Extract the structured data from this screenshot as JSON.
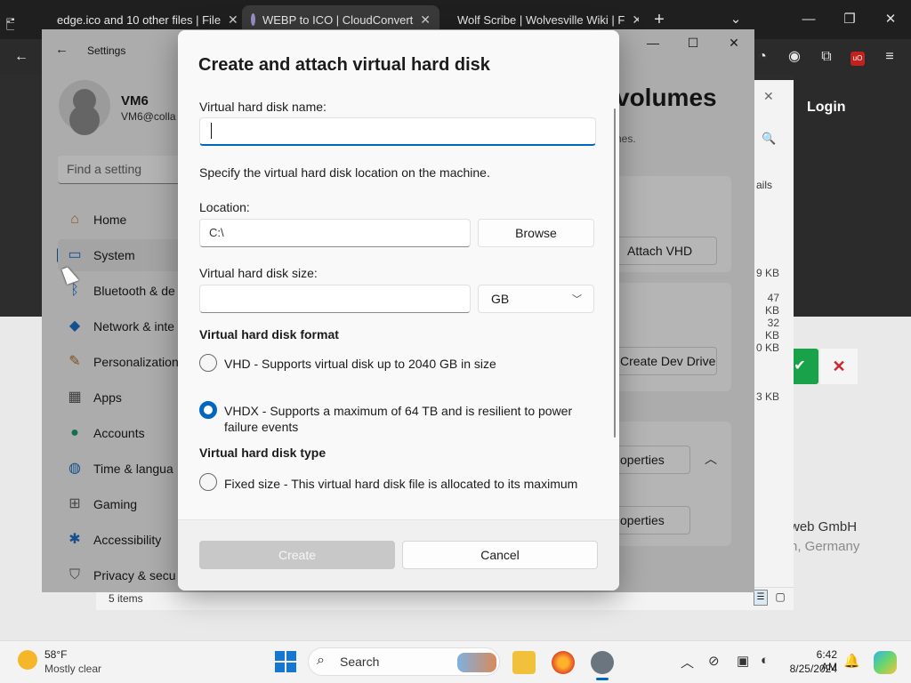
{
  "browser": {
    "tabs": [
      {
        "title": "edge.ico and 10 other files | File",
        "icon": "cloudconvert-red-icon"
      },
      {
        "title": "WEBP to ICO | CloudConvert",
        "icon": "cloudconvert-icon"
      },
      {
        "title": "Wolf Scribe | Wolvesville Wiki | F",
        "icon": "wolf-icon"
      }
    ],
    "new_tab": "+",
    "tab_close": "✕"
  },
  "webpage": {
    "login_title": "Login",
    "company_name": "web GmbH",
    "company_location": "h, Germany"
  },
  "explorer": {
    "file_sizes": [
      "9 KB",
      "47 KB",
      "32 KB",
      "0 KB",
      "3 KB"
    ],
    "partial_label": "ails",
    "items_count": "5 items"
  },
  "settings": {
    "window_title": "Settings",
    "user_name": "VM6",
    "user_email": "VM6@colla",
    "search_placeholder": "Find a setting",
    "nav": [
      {
        "label": "Home",
        "icon": "home-icon"
      },
      {
        "label": "System",
        "icon": "system-icon"
      },
      {
        "label": "Bluetooth & de",
        "icon": "bluetooth-icon"
      },
      {
        "label": "Network & inte",
        "icon": "wifi-icon"
      },
      {
        "label": "Personalization",
        "icon": "brush-icon"
      },
      {
        "label": "Apps",
        "icon": "apps-icon"
      },
      {
        "label": "Accounts",
        "icon": "person-icon"
      },
      {
        "label": "Time & langua",
        "icon": "globe-clock-icon"
      },
      {
        "label": "Gaming",
        "icon": "gamepad-icon"
      },
      {
        "label": "Accessibility",
        "icon": "accessibility-icon"
      },
      {
        "label": "Privacy & secu",
        "icon": "shield-icon"
      }
    ],
    "selected_nav": "System",
    "heading": "volumes",
    "subtitle": "nes.",
    "buttons": {
      "attach_vhd": "Attach VHD",
      "create_dev_drive": "Create Dev Drive",
      "properties_1": "operties",
      "properties_2": "operties"
    }
  },
  "dialog": {
    "title": "Create and attach virtual hard disk",
    "name_label": "Virtual hard disk name:",
    "name_value": "",
    "location_hint": "Specify the virtual hard disk location on the machine.",
    "location_label": "Location:",
    "location_value": "C:\\",
    "browse_label": "Browse",
    "size_label": "Virtual hard disk size:",
    "size_value": "",
    "size_unit": "GB",
    "format_heading": "Virtual hard disk format",
    "format_options": [
      {
        "label": "VHD - Supports virtual disk up to 2040 GB in size",
        "checked": false
      },
      {
        "label": "VHDX - Supports a maximum of 64 TB and is resilient to power failure events",
        "checked": true
      }
    ],
    "type_heading": "Virtual hard disk type",
    "type_options": [
      {
        "label": "Fixed size - This virtual hard disk file is allocated to its maximum",
        "checked": false
      }
    ],
    "create_label": "Create",
    "cancel_label": "Cancel"
  },
  "taskbar": {
    "weather_temp": "58°F",
    "weather_desc": "Mostly clear",
    "search_label": "Search",
    "time": "6:42 AM",
    "date": "8/25/2024"
  },
  "colors": {
    "accent": "#0067c0",
    "disabled_button": "#c8c8c8",
    "confirm_green": "#1aa24a",
    "reject_red": "#d2242b"
  }
}
